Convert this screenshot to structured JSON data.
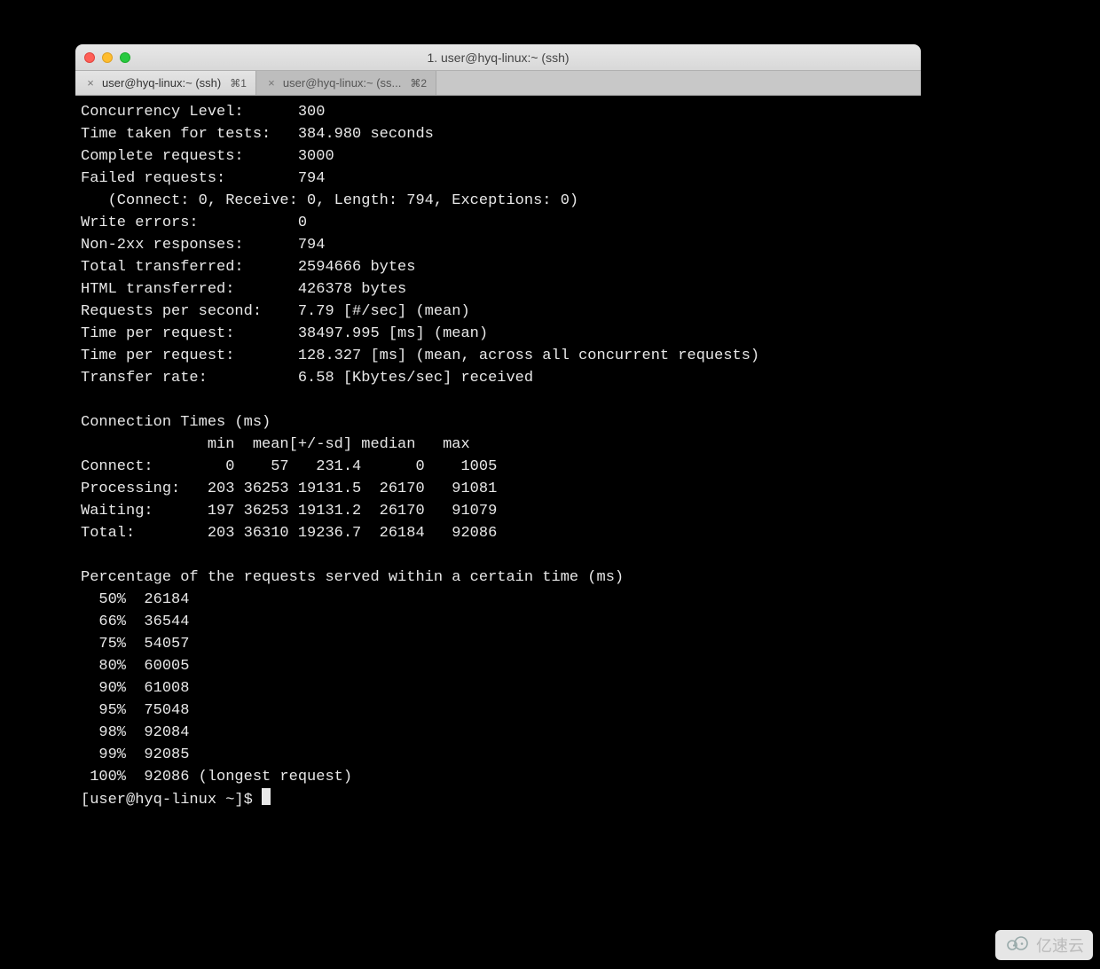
{
  "window": {
    "title": "1. user@hyq-linux:~ (ssh)"
  },
  "tabs": [
    {
      "label": "user@hyq-linux:~ (ssh)",
      "shortcut": "⌘1",
      "active": true
    },
    {
      "label": "user@hyq-linux:~ (ss...",
      "shortcut": "⌘2",
      "active": false
    }
  ],
  "ab": {
    "stats": [
      {
        "label": "Concurrency Level:",
        "value": "300"
      },
      {
        "label": "Time taken for tests:",
        "value": "384.980 seconds"
      },
      {
        "label": "Complete requests:",
        "value": "3000"
      },
      {
        "label": "Failed requests:",
        "value": "794"
      }
    ],
    "failed_detail": "   (Connect: 0, Receive: 0, Length: 794, Exceptions: 0)",
    "stats2": [
      {
        "label": "Write errors:",
        "value": "0"
      },
      {
        "label": "Non-2xx responses:",
        "value": "794"
      },
      {
        "label": "Total transferred:",
        "value": "2594666 bytes"
      },
      {
        "label": "HTML transferred:",
        "value": "426378 bytes"
      },
      {
        "label": "Requests per second:",
        "value": "7.79 [#/sec] (mean)"
      },
      {
        "label": "Time per request:",
        "value": "38497.995 [ms] (mean)"
      },
      {
        "label": "Time per request:",
        "value": "128.327 [ms] (mean, across all concurrent requests)"
      },
      {
        "label": "Transfer rate:",
        "value": "6.58 [Kbytes/sec] received"
      }
    ],
    "conn_header": "Connection Times (ms)",
    "conn_cols": "              min  mean[+/-sd] median   max",
    "conn_rows": [
      {
        "name": "Connect:",
        "min": "0",
        "mean": "57",
        "sd": "231.4",
        "median": "0",
        "max": "1005"
      },
      {
        "name": "Processing:",
        "min": "203",
        "mean": "36253",
        "sd": "19131.5",
        "median": "26170",
        "max": "91081"
      },
      {
        "name": "Waiting:",
        "min": "197",
        "mean": "36253",
        "sd": "19131.2",
        "median": "26170",
        "max": "91079"
      },
      {
        "name": "Total:",
        "min": "203",
        "mean": "36310",
        "sd": "19236.7",
        "median": "26184",
        "max": "92086"
      }
    ],
    "pct_header": "Percentage of the requests served within a certain time (ms)",
    "pct_rows": [
      {
        "pct": "50%",
        "val": "26184",
        "suffix": ""
      },
      {
        "pct": "66%",
        "val": "36544",
        "suffix": ""
      },
      {
        "pct": "75%",
        "val": "54057",
        "suffix": ""
      },
      {
        "pct": "80%",
        "val": "60005",
        "suffix": ""
      },
      {
        "pct": "90%",
        "val": "61008",
        "suffix": ""
      },
      {
        "pct": "95%",
        "val": "75048",
        "suffix": ""
      },
      {
        "pct": "98%",
        "val": "92084",
        "suffix": ""
      },
      {
        "pct": "99%",
        "val": "92085",
        "suffix": ""
      },
      {
        "pct": "100%",
        "val": "92086",
        "suffix": " (longest request)"
      }
    ],
    "prompt": "[user@hyq-linux ~]$ "
  },
  "watermark": "亿速云"
}
